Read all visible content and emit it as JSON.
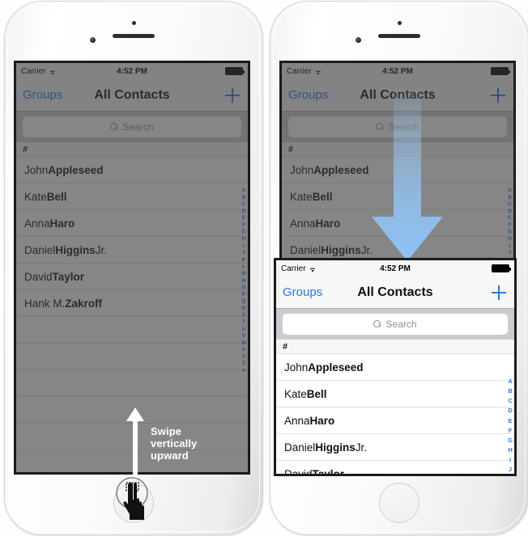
{
  "status_bar": {
    "carrier": "Carrier",
    "wifi_icon": "wifi-icon",
    "time": "4:52 PM",
    "battery_icon": "battery-full-icon"
  },
  "nav_bar": {
    "back_label": "Groups",
    "title": "All Contacts",
    "add_icon": "plus-icon"
  },
  "search": {
    "placeholder": "Search",
    "value": "",
    "icon": "search-icon"
  },
  "contacts": {
    "section_header": "#",
    "rows": [
      {
        "given": "John ",
        "family": "Appleseed",
        "suffix": ""
      },
      {
        "given": "Kate ",
        "family": "Bell",
        "suffix": ""
      },
      {
        "given": "Anna ",
        "family": "Haro",
        "suffix": ""
      },
      {
        "given": "Daniel ",
        "family": "Higgins",
        "suffix": " Jr."
      },
      {
        "given": "David ",
        "family": "Taylor",
        "suffix": ""
      },
      {
        "given": "Hank M. ",
        "family": "Zakroff",
        "suffix": ""
      }
    ]
  },
  "index_full": [
    "A",
    "B",
    "C",
    "D",
    "E",
    "F",
    "G",
    "H",
    "I",
    "J",
    "K",
    "L",
    "M",
    "N",
    "O",
    "P",
    "Q",
    "R",
    "S",
    "T",
    "U",
    "V",
    "W",
    "X",
    "Y",
    "Z",
    "#"
  ],
  "index_short": [
    "A",
    "B",
    "C",
    "D",
    "E",
    "F",
    "G",
    "H",
    "I",
    "J"
  ],
  "annotations": {
    "swipe_label_line1": "Swipe",
    "swipe_label_line2": "vertically",
    "swipe_label_line3": "upward",
    "swipe_arrow_icon": "arrow-up-icon",
    "hand_icon": "hand-tap-icon",
    "blue_arrow_icon": "arrow-down-icon"
  },
  "colors": {
    "accent_blue": "#1f7bec",
    "arrow_blue": "#9ecbf6",
    "dim_overlay": "rgba(60,60,60,0.62)",
    "search_bg": "#c9ccd1",
    "nav_bg": "#f7f7f7"
  }
}
